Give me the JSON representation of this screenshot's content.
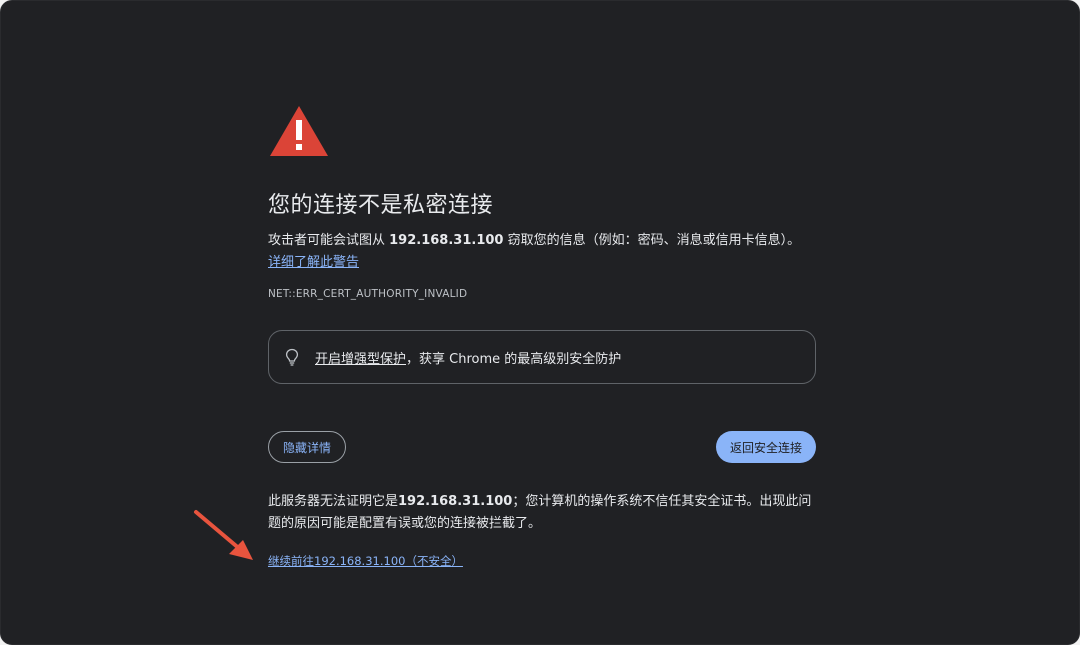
{
  "page": {
    "title": "您的连接不是私密连接",
    "desc_prefix": "攻击者可能会试图从 ",
    "desc_host": "192.168.31.100",
    "desc_suffix": " 窃取您的信息（例如：密码、消息或信用卡信息）。",
    "learn_more": "详细了解此警告",
    "error_code": "NET::ERR_CERT_AUTHORITY_INVALID"
  },
  "protection": {
    "link_text": "开启增强型保护",
    "rest_text": "，获享 Chrome 的最高级别安全防护",
    "icon": "lightbulb-icon"
  },
  "buttons": {
    "hide_details": "隐藏详情",
    "back_to_safety": "返回安全连接"
  },
  "details": {
    "prefix": "此服务器无法证明它是",
    "host": "192.168.31.100",
    "suffix": "；您计算机的操作系统不信任其安全证书。出现此问题的原因可能是配置有误或您的连接被拦截了。",
    "proceed_link": "继续前往192.168.31.100（不安全）"
  },
  "colors": {
    "background": "#202124",
    "warning_red": "#db4437",
    "accent_blue": "#8ab4f8",
    "annotation_arrow": "#e8543e"
  },
  "icons": {
    "warning": "warning-triangle-icon",
    "annotation": "red-arrow-icon"
  }
}
